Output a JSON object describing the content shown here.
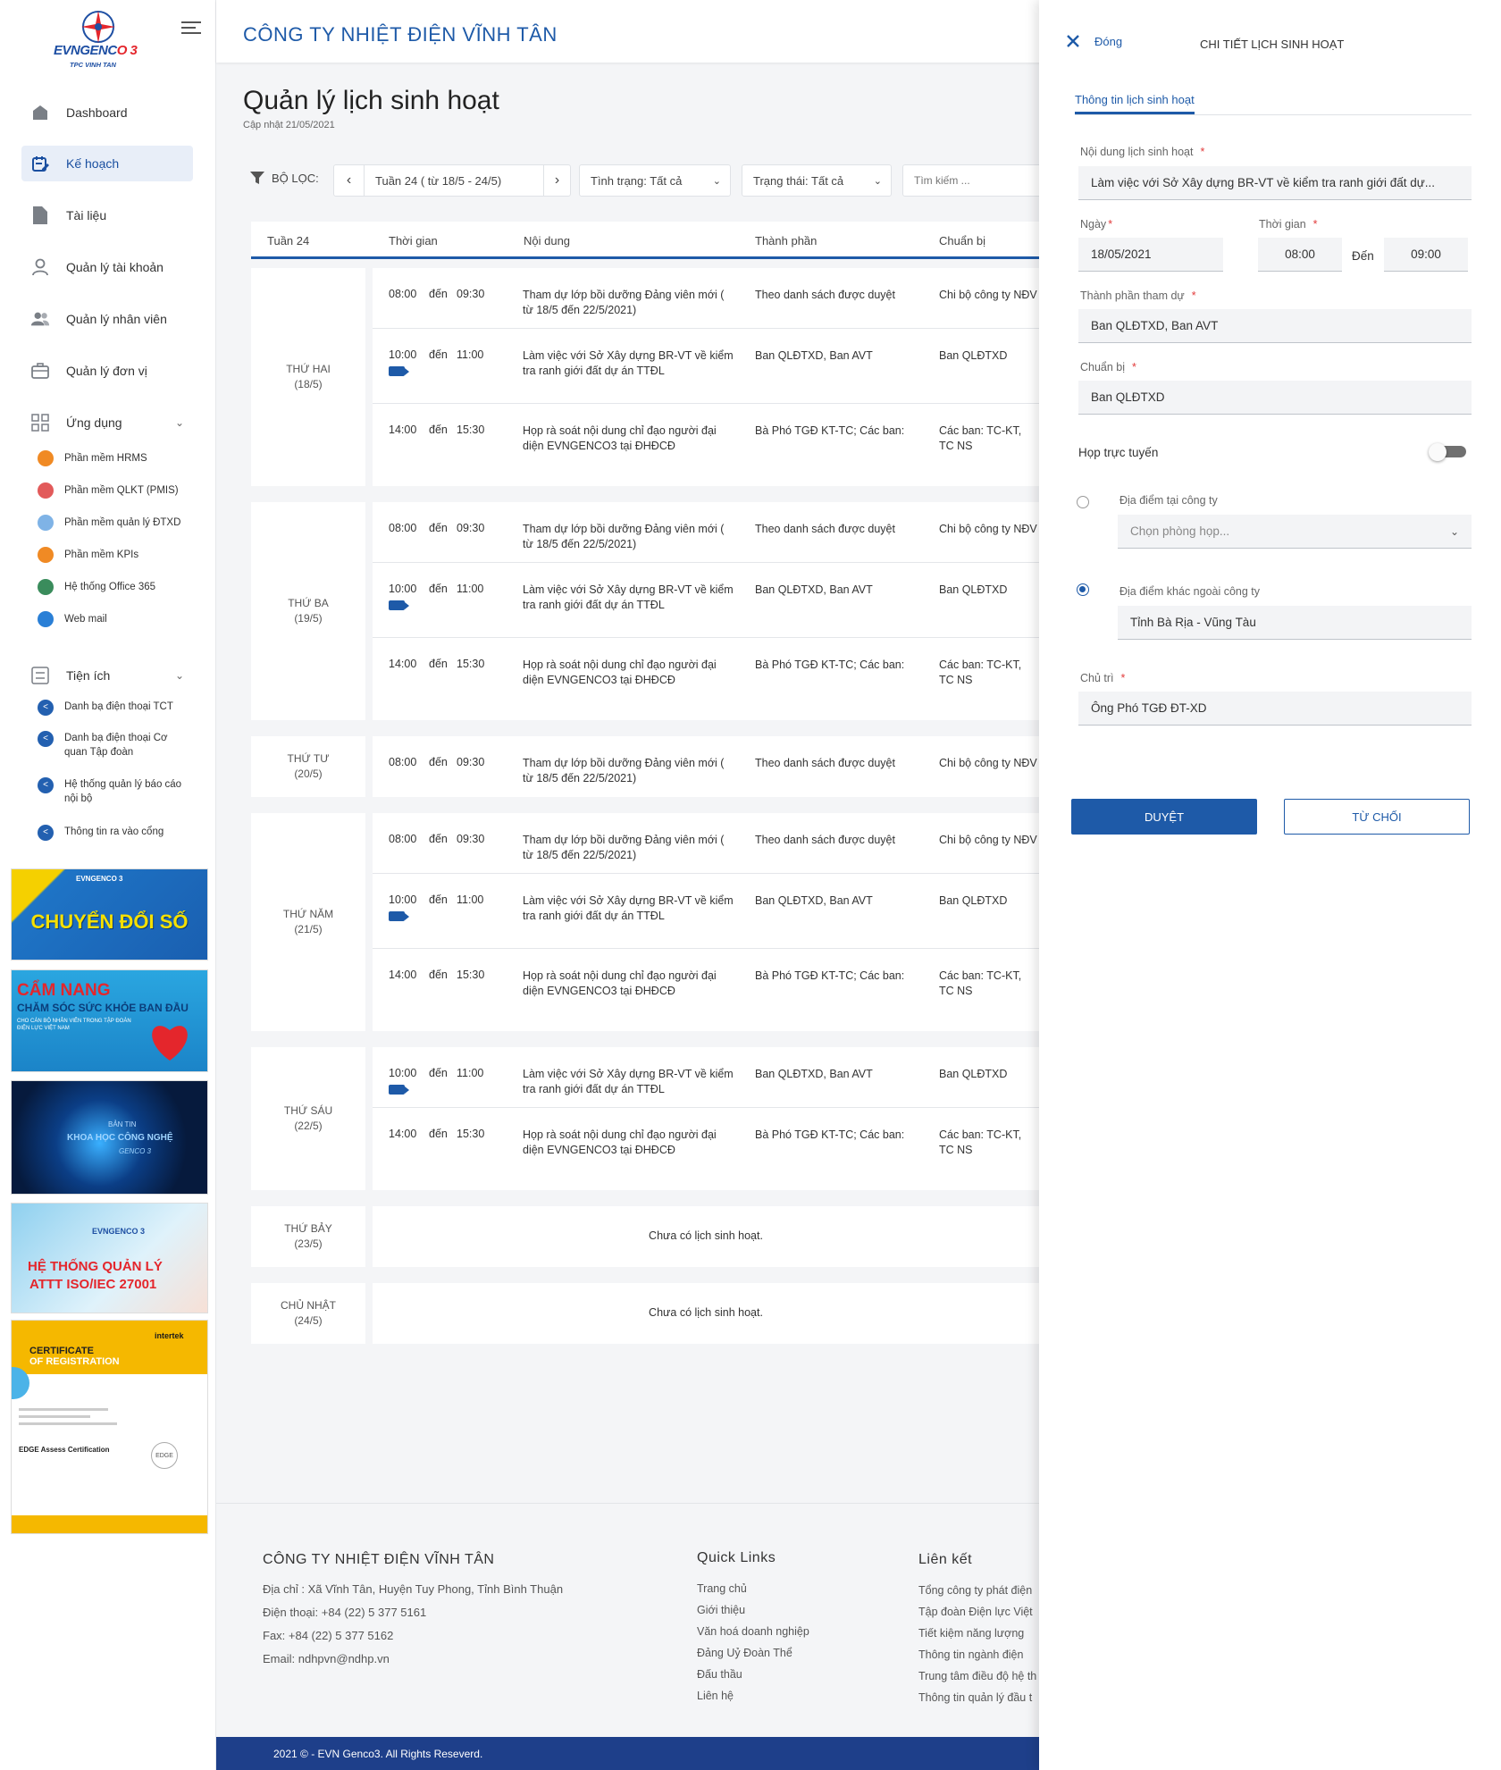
{
  "sidebar": {
    "logo_brand_a": "EVNGENC",
    "logo_brand_b": "O 3",
    "logo_sub": "TPC VINH TAN",
    "nav": [
      "Dashboard",
      "Kế hoạch",
      "Tài liệu",
      "Quản lý tài khoản",
      "Quản lý nhân viên",
      "Quản lý đơn vị"
    ],
    "apps_label": "Ứng dụng",
    "apps": [
      "Phần mềm HRMS",
      "Phần mềm QLKT (PMIS)",
      "Phần mềm quản lý ĐTXD",
      "Phần mềm KPIs",
      "Hệ thống Office 365",
      "Web mail"
    ],
    "utils_label": "Tiện ích",
    "utils": [
      "Danh bạ điện thoại TCT",
      "Danh bạ điện thoại Cơ quan Tập đoàn",
      "Hệ thống quản lý báo cáo nội bộ",
      "Thông tin ra vào cổng"
    ],
    "banners": {
      "b1_top": "EVNGENCO 3",
      "b1": "CHUYỂN ĐỔI SỐ",
      "b2_a": "CẨM NANG",
      "b2_b": "CHĂM SÓC SỨC KHỎE BAN ĐẦU",
      "b2_c": "CHO CÁN BỘ NHÂN VIÊN TRONG TẬP ĐOÀN ĐIỆN LỰC VIỆT NAM",
      "b3_a": "BẢN TIN",
      "b3_b": "KHOA HỌC CÔNG NGHỆ",
      "b3_c": "GENCO 3",
      "b4_top": "EVNGENCO 3",
      "b4_a": "HỆ THỐNG QUẢN LÝ",
      "b4_b": "ATTT ISO/IEC 27001",
      "b5_brand": "intertek",
      "b5_a": "CERTIFICATE",
      "b5_b": "OF REGISTRATION",
      "b5_c": "EDGE Assess Certification",
      "b5_seal": "EDGE"
    }
  },
  "header": {
    "company": "CÔNG TY NHIỆT ĐIỆN VĨNH TÂN"
  },
  "page": {
    "title": "Quản lý lịch sinh hoạt",
    "updated": "Cập nhật 21/05/2021"
  },
  "filters": {
    "label": "BỘ LỌC:",
    "week": "Tuần 24 ( từ 18/5 - 24/5)",
    "status": "Tình trạng: Tất cả",
    "state": "Trạng thái: Tất cả",
    "search_placeholder": "Tìm kiếm ..."
  },
  "table": {
    "headers": [
      "Tuần 24",
      "Thời gian",
      "Nội dung",
      "Thành phần",
      "Chuẩn bị"
    ],
    "to_word": "đến",
    "empty_text": "Chưa có lịch sinh hoạt.",
    "days": [
      {
        "name": "THỨ HAI",
        "date": "(18/5)",
        "events": [
          {
            "start": "08:00",
            "end": "09:30",
            "online": false,
            "content": "Tham dự lớp bồi dưỡng Đảng viên mới ( từ 18/5 đến 22/5/2021)",
            "members": "Theo danh sách được duyệt",
            "prep": "Chi bộ công ty NĐV"
          },
          {
            "start": "10:00",
            "end": "11:00",
            "online": true,
            "content": "Làm việc với Sở Xây dựng BR-VT về kiểm tra ranh giới đất dự án TTĐL",
            "members": "Ban QLĐTXD, Ban AVT",
            "prep": "Ban QLĐTXD"
          },
          {
            "start": "14:00",
            "end": "15:30",
            "online": false,
            "content": "Họp rà soát nội dung chỉ đạo người đại diện EVNGENCO3 tại ĐHĐCĐ",
            "members": "Bà Phó TGĐ KT-TC; Các ban:",
            "prep": "Các ban: TC-KT, TC NS"
          }
        ]
      },
      {
        "name": "THỨ BA",
        "date": "(19/5)",
        "events": [
          {
            "start": "08:00",
            "end": "09:30",
            "online": false,
            "content": "Tham dự lớp bồi dưỡng Đảng viên mới ( từ 18/5 đến 22/5/2021)",
            "members": "Theo danh sách được duyệt",
            "prep": "Chi bộ công ty NĐV"
          },
          {
            "start": "10:00",
            "end": "11:00",
            "online": true,
            "content": "Làm việc với Sở Xây dựng BR-VT về kiểm tra ranh giới đất dự án TTĐL",
            "members": "Ban QLĐTXD, Ban AVT",
            "prep": "Ban QLĐTXD"
          },
          {
            "start": "14:00",
            "end": "15:30",
            "online": false,
            "content": "Họp rà soát nội dung chỉ đạo người đại diện EVNGENCO3 tại ĐHĐCĐ",
            "members": "Bà Phó TGĐ KT-TC; Các ban:",
            "prep": "Các ban: TC-KT, TC NS"
          }
        ]
      },
      {
        "name": "THỨ TƯ",
        "date": "(20/5)",
        "events": [
          {
            "start": "08:00",
            "end": "09:30",
            "online": false,
            "content": "Tham dự lớp bồi dưỡng Đảng viên mới ( từ 18/5 đến 22/5/2021)",
            "members": "Theo danh sách được duyệt",
            "prep": "Chi bộ công ty NĐV"
          }
        ]
      },
      {
        "name": "THỨ NĂM",
        "date": "(21/5)",
        "events": [
          {
            "start": "08:00",
            "end": "09:30",
            "online": false,
            "content": "Tham dự lớp bồi dưỡng Đảng viên mới ( từ 18/5 đến 22/5/2021)",
            "members": "Theo danh sách được duyệt",
            "prep": "Chi bộ công ty NĐV"
          },
          {
            "start": "10:00",
            "end": "11:00",
            "online": true,
            "content": "Làm việc với Sở Xây dựng BR-VT về kiểm tra ranh giới đất dự án TTĐL",
            "members": "Ban QLĐTXD, Ban AVT",
            "prep": "Ban QLĐTXD"
          },
          {
            "start": "14:00",
            "end": "15:30",
            "online": false,
            "content": "Họp rà soát nội dung chỉ đạo người đại diện EVNGENCO3 tại ĐHĐCĐ",
            "members": "Bà Phó TGĐ KT-TC; Các ban:",
            "prep": "Các ban: TC-KT, TC NS"
          }
        ]
      },
      {
        "name": "THỨ SÁU",
        "date": "(22/5)",
        "events": [
          {
            "start": "10:00",
            "end": "11:00",
            "online": true,
            "content": "Làm việc với Sở Xây dựng BR-VT về kiểm tra ranh giới đất dự án TTĐL",
            "members": "Ban QLĐTXD, Ban AVT",
            "prep": "Ban QLĐTXD"
          },
          {
            "start": "14:00",
            "end": "15:30",
            "online": false,
            "content": "Họp rà soát nội dung chỉ đạo người đại diện EVNGENCO3 tại ĐHĐCĐ",
            "members": "Bà Phó TGĐ KT-TC; Các ban:",
            "prep": "Các ban: TC-KT, TC NS"
          }
        ]
      },
      {
        "name": "THỨ BẢY",
        "date": "(23/5)",
        "events": []
      },
      {
        "name": "CHỦ NHẬT",
        "date": "(24/5)",
        "events": []
      }
    ]
  },
  "footer": {
    "company": "CÔNG TY NHIỆT ĐIỆN VĨNH TÂN",
    "address": "Địa chỉ : Xã Vĩnh Tân, Huyện Tuy Phong, Tỉnh Bình Thuận",
    "phone": "Điện thoại: +84 (22) 5 377 5161",
    "fax": "Fax: +84 (22) 5 377 5162",
    "email": "Email: ndhpvn@ndhp.vn",
    "quick_title": "Quick Links",
    "quick": [
      "Trang chủ",
      "Giới thiệu",
      "Văn hoá doanh nghiệp",
      "Đảng Uỷ Đoàn Thể",
      "Đấu thầu",
      "Liên hệ"
    ],
    "links_title": "Liên kết",
    "links": [
      "Tổng công ty phát điện",
      "Tập đoàn Điện lực Việt",
      "Tiết kiệm năng lượng",
      "Thông tin ngành điện",
      "Trung tâm điều độ hệ th",
      "Thông tin quản lý đầu t"
    ],
    "copyright": "2021 © - EVN Genco3. All Rights Reseverd."
  },
  "panel": {
    "close": "Đóng",
    "title": "CHI TIẾT LỊCH SINH HOẠT",
    "tab": "Thông tin lịch sinh hoạt",
    "content_label": "Nội dung lịch sinh hoạt",
    "content_value": "Làm việc với Sở Xây dựng BR-VT về kiểm tra ranh giới đất dự...",
    "date_label": "Ngày",
    "date_value": "18/05/2021",
    "time_label": "Thời gian",
    "time_start": "08:00",
    "to_label": "Đến",
    "time_end": "09:00",
    "members_label": "Thành phần tham dự",
    "members_value": "Ban QLĐTXD, Ban AVT",
    "prep_label": "Chuẩn bị",
    "prep_value": "Ban QLĐTXD",
    "online_label": "Họp trực tuyến",
    "online_on": false,
    "loc_in_label": "Địa điểm tại công ty",
    "loc_in_placeholder": "Chọn phòng họp...",
    "loc_out_label": "Địa điểm khác ngoài công ty",
    "loc_out_value": "Tỉnh Bà Rịa - Vũng Tàu",
    "host_label": "Chủ trì",
    "host_value": "Ông Phó TGĐ ĐT-XD",
    "approve": "DUYỆT",
    "reject": "TỪ CHỐI"
  },
  "colors": {
    "primary": "#1e5aa8",
    "footer_bar": "#1e3f8a",
    "nav_active_bg": "#e8eef8"
  }
}
